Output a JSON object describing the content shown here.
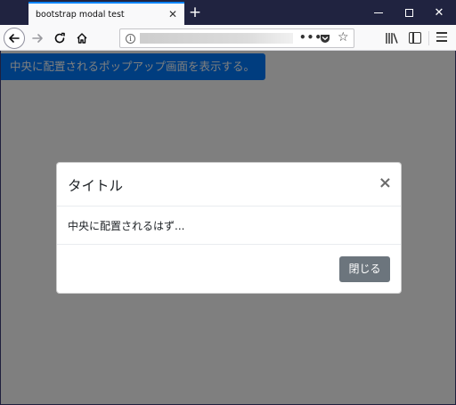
{
  "browser": {
    "tab_title": "bootstrap modal test",
    "tab_close_icon": "close-icon",
    "new_tab_label": "+",
    "window_controls": [
      "minimize-icon",
      "maximize-icon",
      "close-icon"
    ],
    "nav": {
      "back_icon": "back-arrow-icon",
      "forward_icon": "forward-arrow-icon",
      "reload_icon": "reload-icon",
      "home_icon": "home-icon"
    },
    "url_actions": "•••",
    "info_glyph": "i",
    "star_glyph": "☆",
    "close_glyph": "✕"
  },
  "page": {
    "open_button_label": "中央に配置されるポップアップ画面を表示する。"
  },
  "modal": {
    "title": "タイトル",
    "close_glyph": "×",
    "body_text": "中央に配置されるはず...",
    "close_button_label": "閉じる"
  },
  "colors": {
    "tab_accent": "#0a84ff",
    "titlebar": "#202340",
    "primary_button": "#007bff",
    "secondary_button": "#6c757d",
    "backdrop": "rgba(0,0,0,0.5)"
  }
}
